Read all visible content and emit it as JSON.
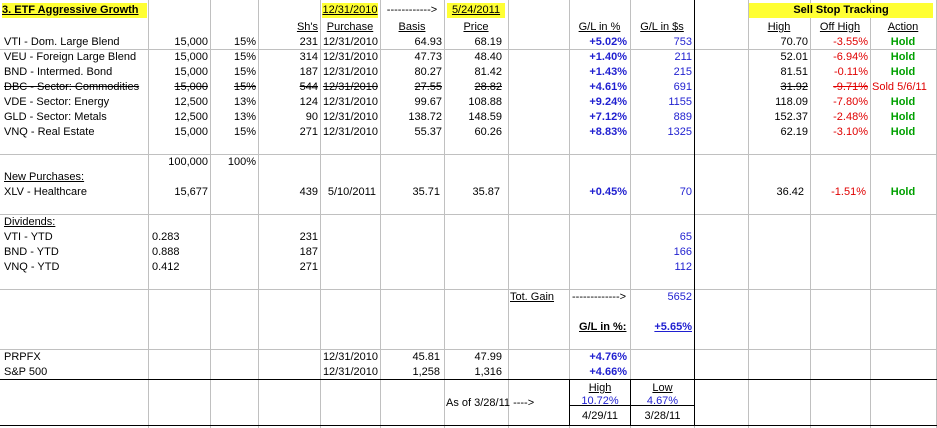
{
  "title": "3. ETF Aggressive Growth",
  "headers": {
    "date1": "12/31/2010",
    "arrow": "------------>",
    "date2": "5/24/2011",
    "shares": "Sh's",
    "purchase": "Purchase",
    "basis": "Basis",
    "price": "Price",
    "gl_pct": "G/L in %",
    "gl_usd": "G/L in $s",
    "stop_title": "Sell Stop Tracking",
    "high": "High",
    "off_high": "Off High",
    "action": "Action"
  },
  "rows": [
    {
      "name": "VTI - Dom. Large Blend",
      "alloc": "15,000",
      "pct": "15%",
      "shares": "231",
      "date": "12/31/2010",
      "basis": "64.93",
      "price": "68.19",
      "glp": "+5.02%",
      "gld": "753",
      "high": "70.70",
      "off": "-3.55%",
      "action": "Hold"
    },
    {
      "name": "VEU - Foreign Large Blend",
      "alloc": "15,000",
      "pct": "15%",
      "shares": "314",
      "date": "12/31/2010",
      "basis": "47.73",
      "price": "48.40",
      "glp": "+1.40%",
      "gld": "211",
      "high": "52.01",
      "off": "-6.94%",
      "action": "Hold"
    },
    {
      "name": "BND - Intermed. Bond",
      "alloc": "15,000",
      "pct": "15%",
      "shares": "187",
      "date": "12/31/2010",
      "basis": "80.27",
      "price": "81.42",
      "glp": "+1.43%",
      "gld": "215",
      "high": "81.51",
      "off": "-0.11%",
      "action": "Hold"
    },
    {
      "name": "DBC - Sector: Commodities",
      "alloc": "15,000",
      "pct": "15%",
      "shares": "544",
      "date": "12/31/2010",
      "basis": "27.55",
      "price": "28.82",
      "glp": "+4.61%",
      "gld": "691",
      "high": "31.92",
      "off": "-9.71%",
      "action": "Sold 5/6/11"
    },
    {
      "name": "VDE - Sector: Energy",
      "alloc": "12,500",
      "pct": "13%",
      "shares": "124",
      "date": "12/31/2010",
      "basis": "99.67",
      "price": "108.88",
      "glp": "+9.24%",
      "gld": "1155",
      "high": "118.09",
      "off": "-7.80%",
      "action": "Hold"
    },
    {
      "name": "GLD - Sector: Metals",
      "alloc": "12,500",
      "pct": "13%",
      "shares": "90",
      "date": "12/31/2010",
      "basis": "138.72",
      "price": "148.59",
      "glp": "+7.12%",
      "gld": "889",
      "high": "152.37",
      "off": "-2.48%",
      "action": "Hold"
    },
    {
      "name": "VNQ - Real Estate",
      "alloc": "15,000",
      "pct": "15%",
      "shares": "271",
      "date": "12/31/2010",
      "basis": "55.37",
      "price": "60.26",
      "glp": "+8.83%",
      "gld": "1325",
      "high": "62.19",
      "off": "-3.10%",
      "action": "Hold"
    }
  ],
  "totals": {
    "alloc": "100,000",
    "pct": "100%"
  },
  "new_purchases": {
    "label": "New Purchases:",
    "row": {
      "name": "XLV - Healthcare",
      "alloc": "15,677",
      "shares": "439",
      "date": "5/10/2011",
      "basis": "35.71",
      "price": "35.87",
      "glp": "+0.45%",
      "gld": "70",
      "high": "36.42",
      "off": "-1.51%",
      "action": "Hold"
    }
  },
  "dividends": {
    "label": "Dividends:",
    "rows": [
      {
        "name": "VTI - YTD",
        "amount": "0.283",
        "shares": "231",
        "gld": "65"
      },
      {
        "name": "BND - YTD",
        "amount": "0.888",
        "shares": "187",
        "gld": "166"
      },
      {
        "name": "VNQ - YTD",
        "amount": "0.412",
        "shares": "271",
        "gld": "112"
      }
    ]
  },
  "summary": {
    "tot_gain_label": "Tot. Gain",
    "tot_gain_arrow": "------------->",
    "tot_gain": "5652",
    "gl_pct_label": "G/L in %:",
    "gl_pct": "+5.65%"
  },
  "benchmarks": [
    {
      "name": "PRPFX",
      "date": "12/31/2010",
      "basis": "45.81",
      "price": "47.99",
      "glp": "+4.76%"
    },
    {
      "name": "S&P 500",
      "date": "12/31/2010",
      "basis": "1,258",
      "price": "1,316",
      "glp": "+4.66%"
    }
  ],
  "highlow": {
    "asof": "As of 3/28/11 ---->",
    "high_label": "High",
    "low_label": "Low",
    "high_pct": "10.72%",
    "low_pct": "4.67%",
    "high_date": "4/29/11",
    "low_date": "3/28/11"
  }
}
